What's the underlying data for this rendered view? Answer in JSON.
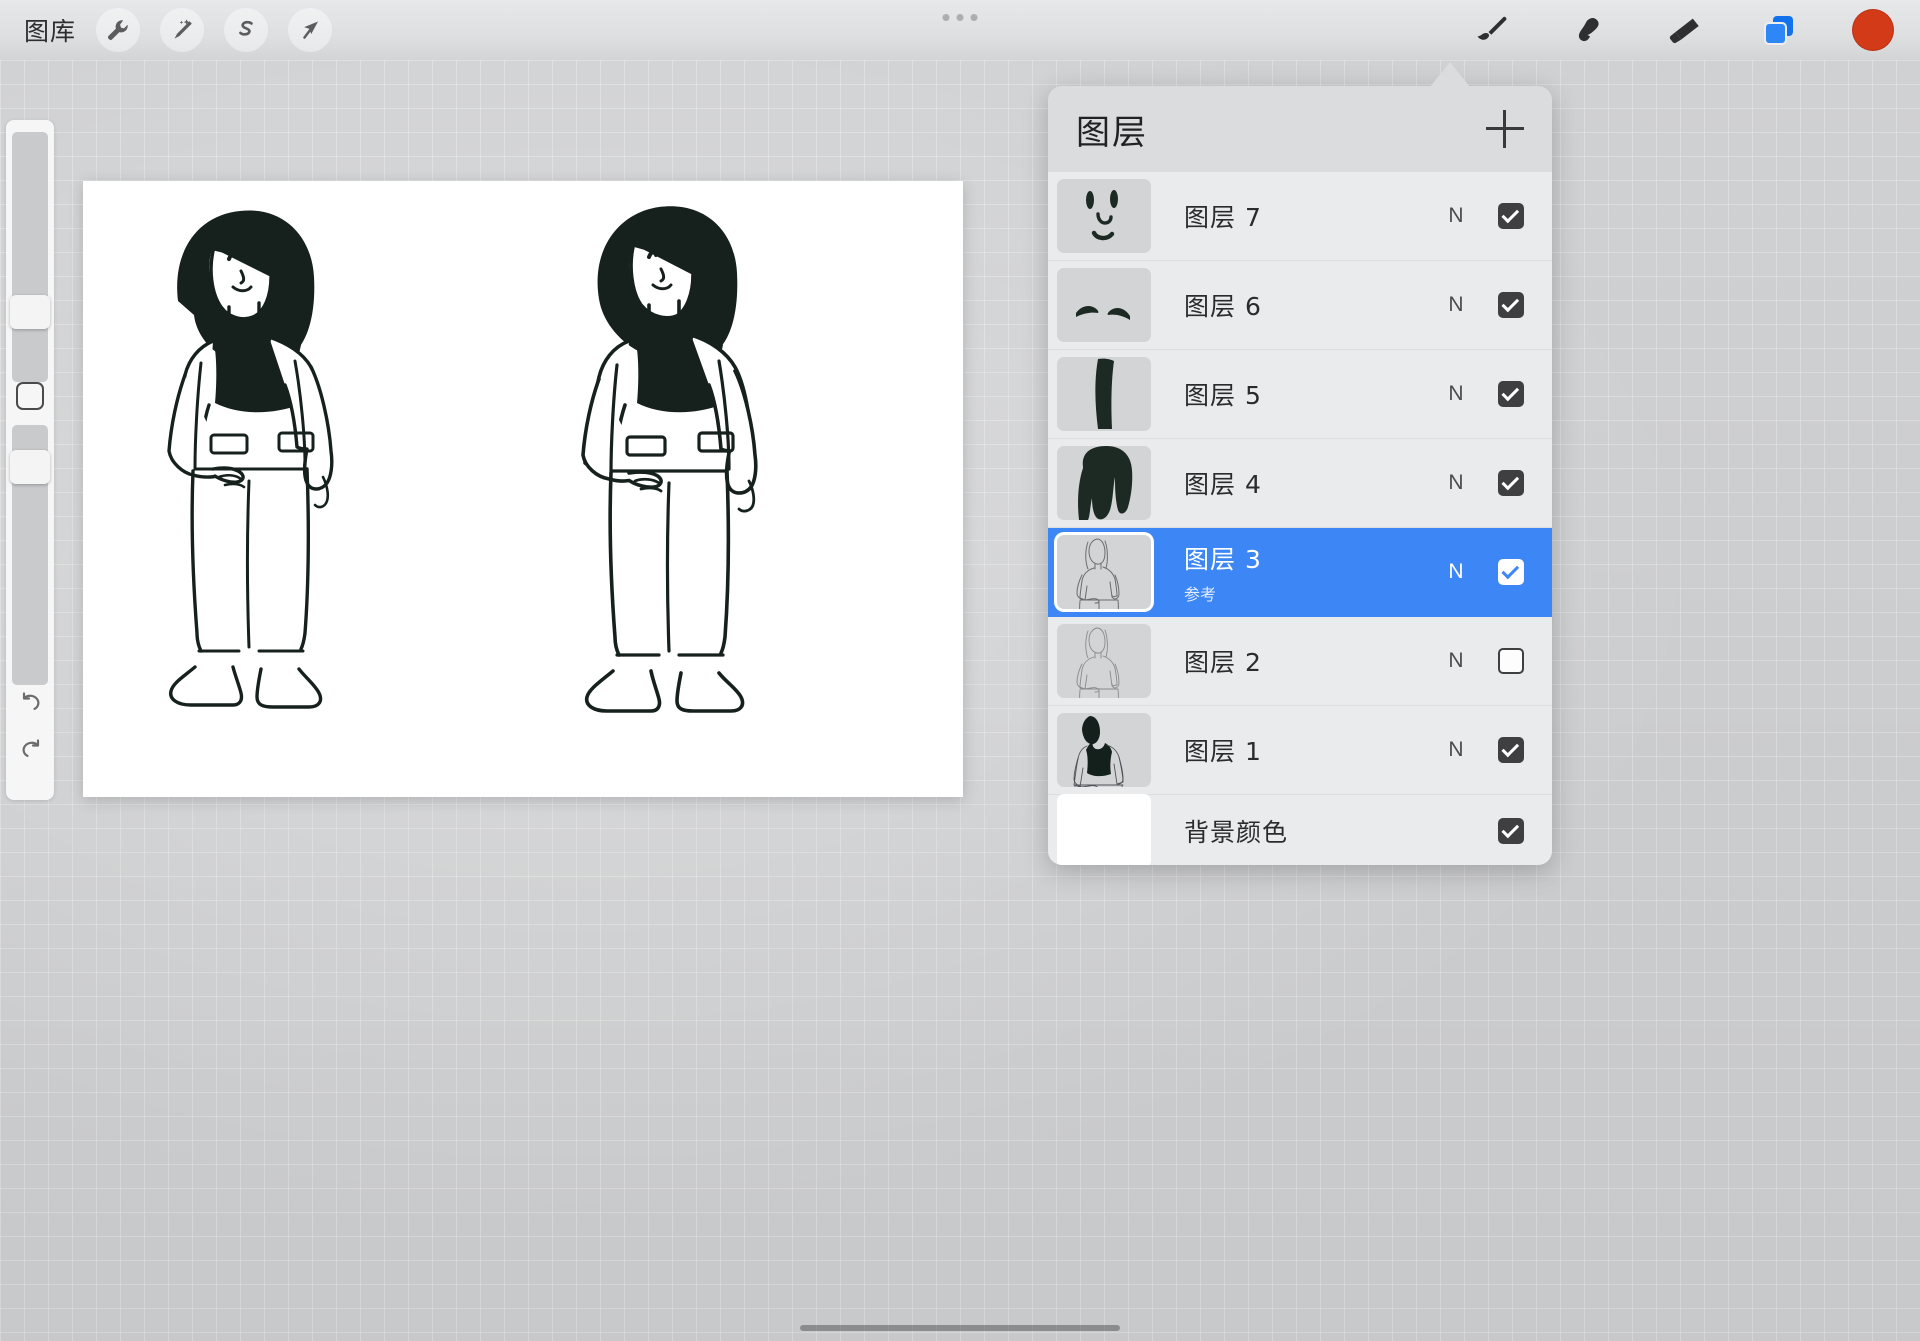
{
  "app": {
    "gallery_label": "图库",
    "top_left_tools": [
      {
        "name": "wrench-icon",
        "label": "调整"
      },
      {
        "name": "magic-wand-icon",
        "label": "魔棒"
      },
      {
        "name": "s-selection-icon",
        "label": "选取"
      },
      {
        "name": "arrow-transform-icon",
        "label": "变换"
      }
    ],
    "top_right_tools": [
      {
        "name": "brush-icon",
        "label": "画笔",
        "active": false
      },
      {
        "name": "smudge-icon",
        "label": "涂抹",
        "active": false
      },
      {
        "name": "eraser-icon",
        "label": "橡皮擦",
        "active": false
      },
      {
        "name": "layers-icon",
        "label": "图层",
        "active": true
      }
    ],
    "color_swatch": "#d33a18",
    "accent_color": "#3d86f5"
  },
  "panel": {
    "title": "图层",
    "add_label": "+",
    "layers": [
      {
        "name": "图层 7",
        "sub": "",
        "blend": "N",
        "visible": true,
        "selected": false,
        "thumb": "face-features"
      },
      {
        "name": "图层 6",
        "sub": "",
        "blend": "N",
        "visible": true,
        "selected": false,
        "thumb": "eyebrows"
      },
      {
        "name": "图层 5",
        "sub": "",
        "blend": "N",
        "visible": true,
        "selected": false,
        "thumb": "hair-strand"
      },
      {
        "name": "图层 4",
        "sub": "",
        "blend": "N",
        "visible": true,
        "selected": false,
        "thumb": "hair"
      },
      {
        "name": "图层 3",
        "sub": "参考",
        "blend": "N",
        "visible": true,
        "selected": true,
        "thumb": "figure-outline"
      },
      {
        "name": "图层 2",
        "sub": "",
        "blend": "N",
        "visible": false,
        "selected": false,
        "thumb": "figure-sketch"
      },
      {
        "name": "图层 1",
        "sub": "",
        "blend": "N",
        "visible": true,
        "selected": false,
        "thumb": "figure-inked"
      },
      {
        "name": "背景颜色",
        "sub": "",
        "blend": "",
        "visible": true,
        "selected": false,
        "thumb": "white-swatch"
      }
    ]
  },
  "canvas": {
    "background": "#ffffff",
    "description": "两个身穿西装外套和长裤的女性角色线稿"
  }
}
